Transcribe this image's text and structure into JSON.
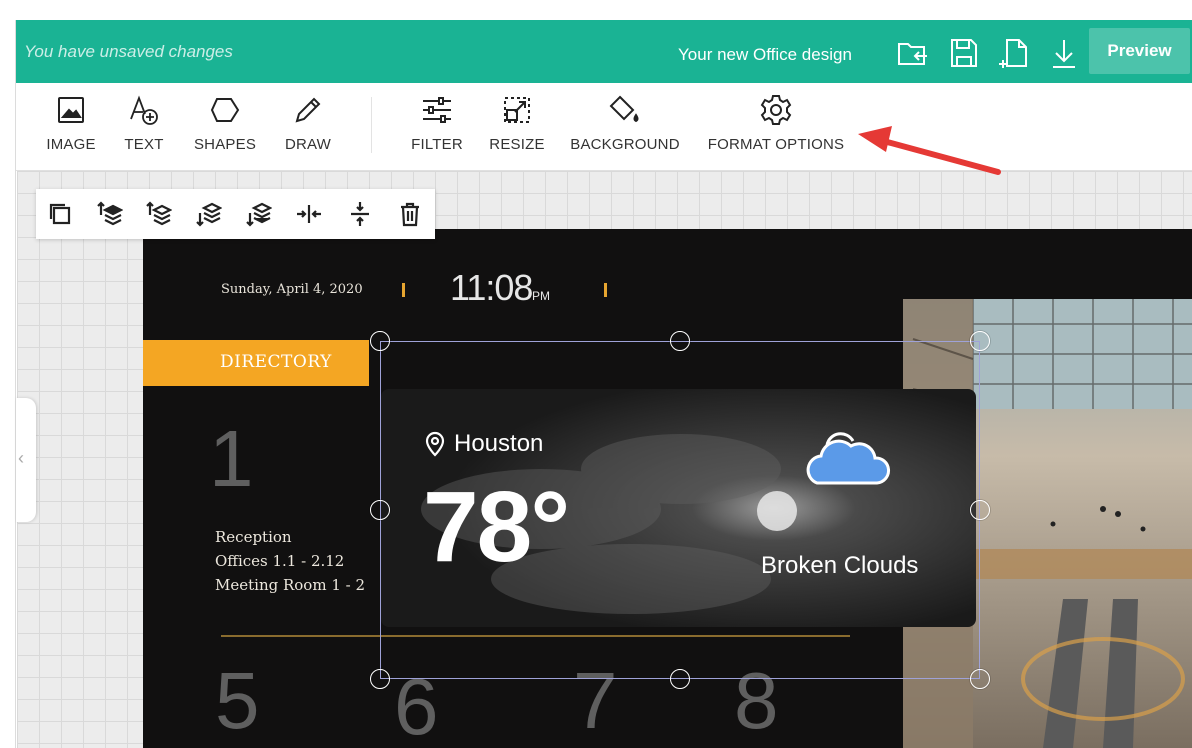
{
  "topbar": {
    "unsaved_text": "You have unsaved changes",
    "design_name": "Your new Office design",
    "icons": [
      "open-folder-icon",
      "save-icon",
      "new-page-icon",
      "download-icon"
    ],
    "preview_label": "Preview",
    "background_color": "#1ab394"
  },
  "toolbar": {
    "tools": [
      {
        "name": "image",
        "label": "IMAGE"
      },
      {
        "name": "text",
        "label": "TEXT"
      },
      {
        "name": "shapes",
        "label": "SHAPES"
      },
      {
        "name": "draw",
        "label": "DRAW"
      },
      {
        "name": "filter",
        "label": "FILTER"
      },
      {
        "name": "resize",
        "label": "RESIZE"
      },
      {
        "name": "background",
        "label": "BACKGROUND"
      },
      {
        "name": "format-options",
        "label": "FORMAT OPTIONS"
      }
    ]
  },
  "layer_actions": [
    "duplicate-icon",
    "bring-to-front-icon",
    "bring-forward-icon",
    "send-backward-icon",
    "send-to-back-icon",
    "align-horizontal-center-icon",
    "align-vertical-center-icon",
    "delete-icon"
  ],
  "design": {
    "date": "Sunday, April 4, 2020",
    "time": "11:08",
    "ampm": "PM",
    "directory_title": "DIRECTORY",
    "numbers": {
      "n1": "1",
      "n5": "5",
      "n6": "6",
      "n7": "7",
      "n8": "8"
    },
    "directory_items": [
      "Reception",
      "Offices 1.1 - 2.12",
      "Meeting Room 1 - 2"
    ],
    "accent_color": "#f4a623"
  },
  "weather": {
    "city": "Houston",
    "temperature": "78°",
    "condition": "Broken Clouds",
    "cloud_color": "#5b9ae8"
  }
}
